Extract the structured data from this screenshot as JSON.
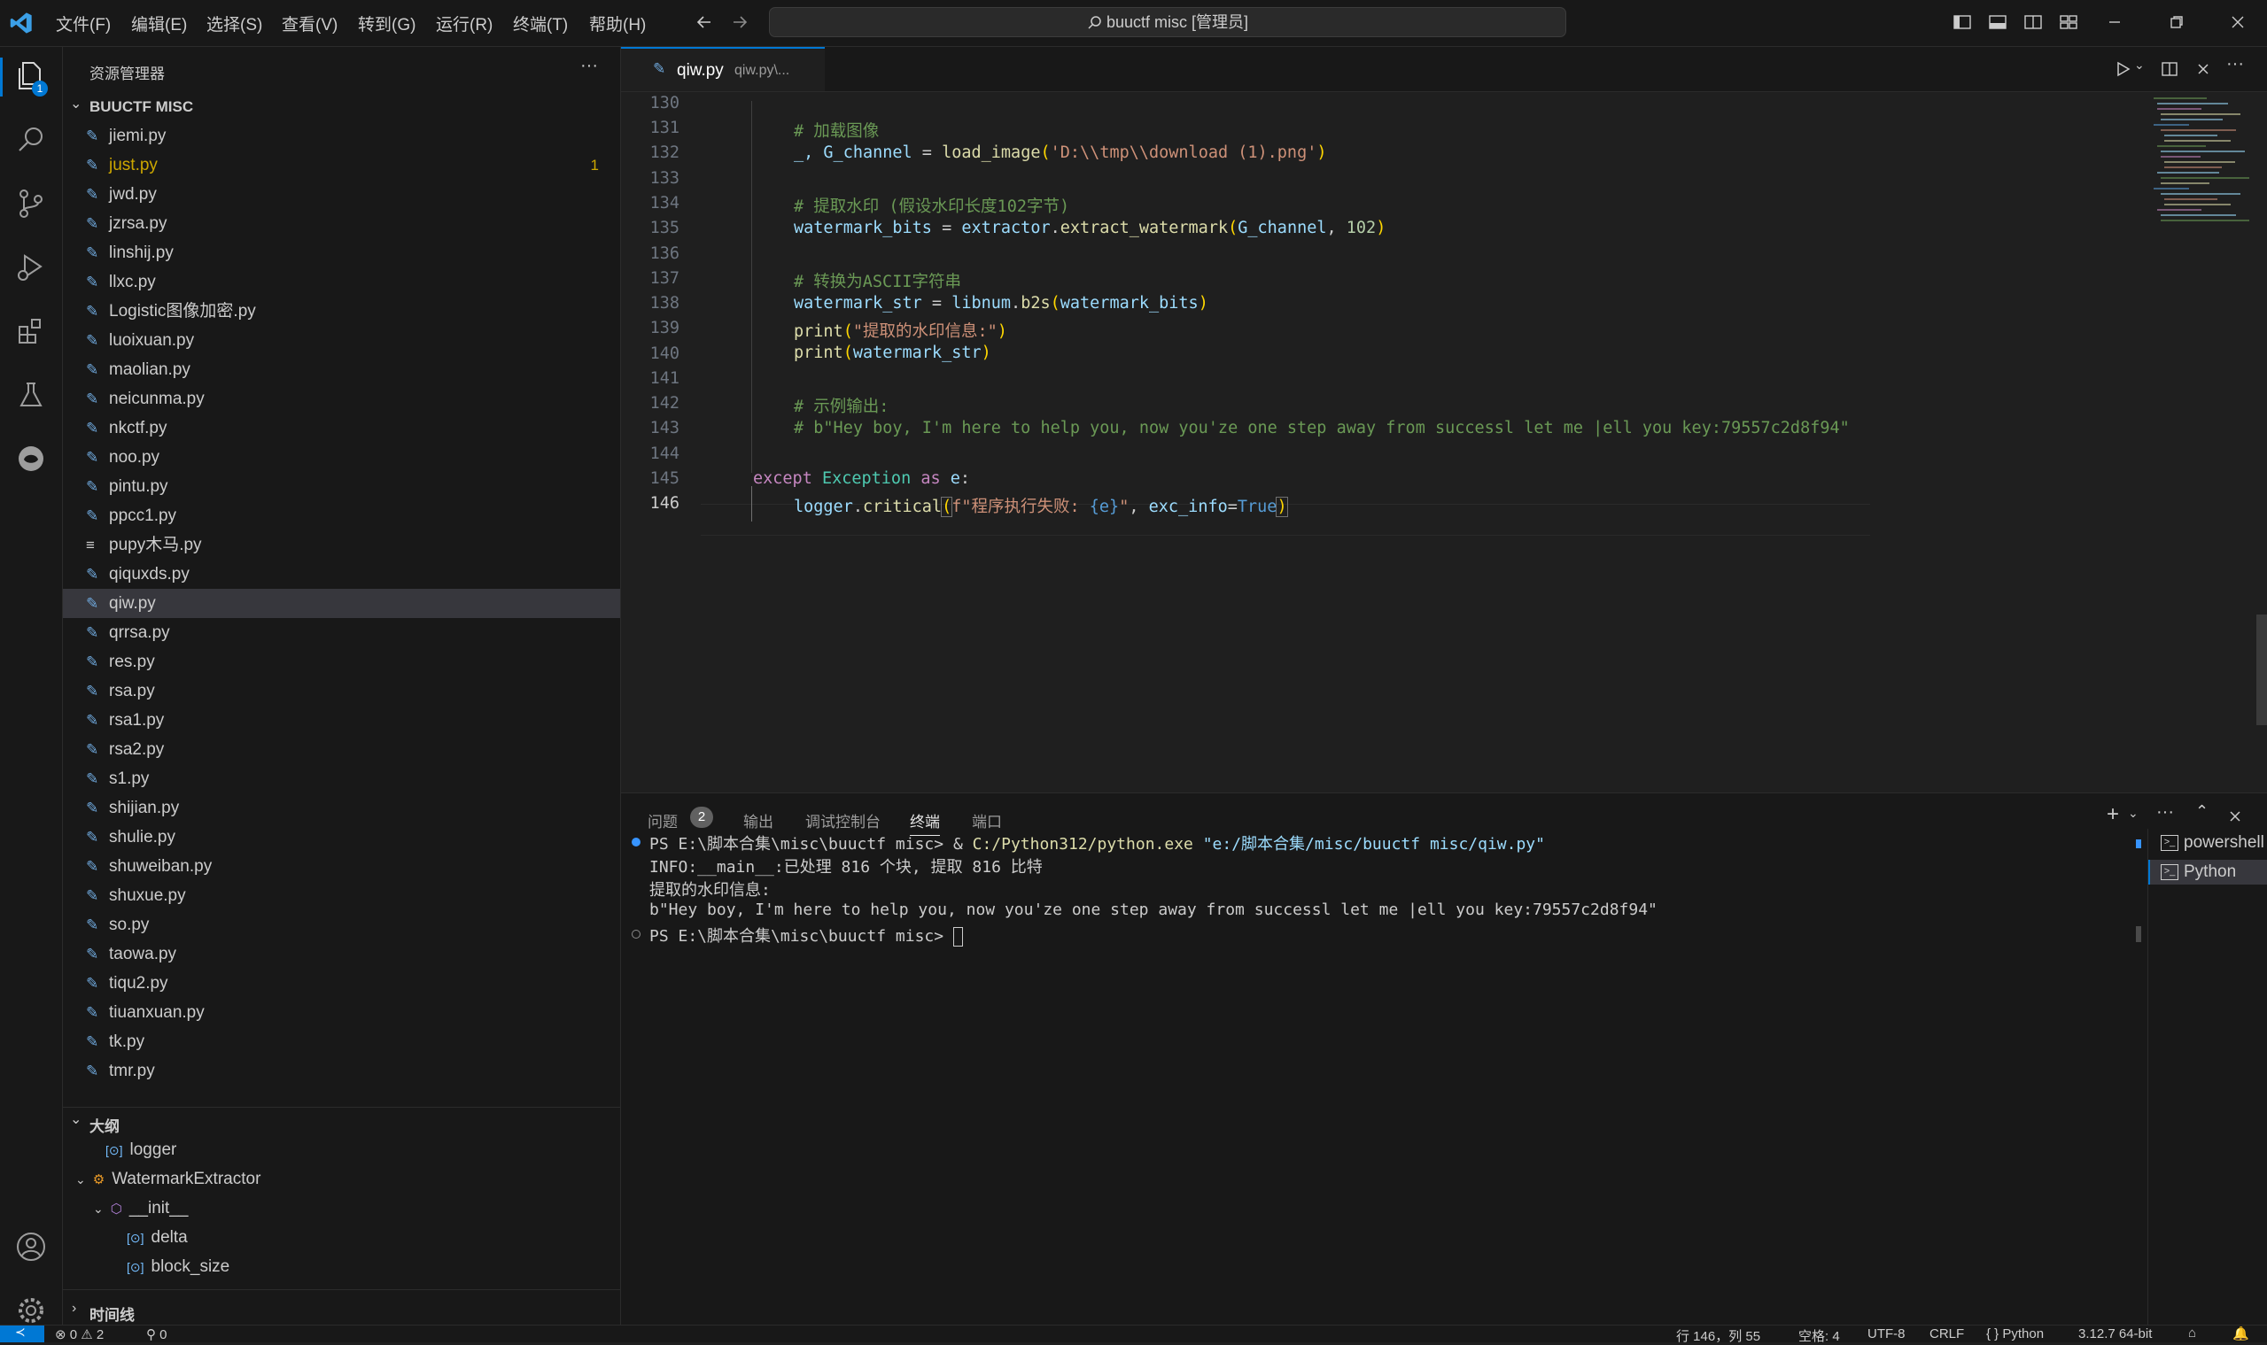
{
  "titlebar": {
    "menus": [
      "文件(F)",
      "编辑(E)",
      "选择(S)",
      "查看(V)",
      "转到(G)",
      "运行(R)",
      "终端(T)",
      "帮助(H)"
    ],
    "search_text": "buuctf misc [管理员]"
  },
  "activity": {
    "explorer_badge": "1"
  },
  "sidebar": {
    "title": "资源管理器",
    "folder": "BUUCTF MISC",
    "files": [
      {
        "name": "jiemi.py",
        "badge": ""
      },
      {
        "name": "just.py",
        "badge": "1"
      },
      {
        "name": "jwd.py",
        "badge": ""
      },
      {
        "name": "jzrsa.py",
        "badge": ""
      },
      {
        "name": "linshij.py",
        "badge": ""
      },
      {
        "name": "llxc.py",
        "badge": ""
      },
      {
        "name": "Logistic图像加密.py",
        "badge": ""
      },
      {
        "name": "luoixuan.py",
        "badge": ""
      },
      {
        "name": "maolian.py",
        "badge": ""
      },
      {
        "name": "neicunma.py",
        "badge": ""
      },
      {
        "name": "nkctf.py",
        "badge": ""
      },
      {
        "name": "noo.py",
        "badge": ""
      },
      {
        "name": "pintu.py",
        "badge": ""
      },
      {
        "name": "ppcc1.py",
        "badge": ""
      },
      {
        "name": "pupy木马.py",
        "badge": ""
      },
      {
        "name": "qiquxds.py",
        "badge": ""
      },
      {
        "name": "qiw.py",
        "badge": ""
      },
      {
        "name": "qrrsa.py",
        "badge": ""
      },
      {
        "name": "res.py",
        "badge": ""
      },
      {
        "name": "rsa.py",
        "badge": ""
      },
      {
        "name": "rsa1.py",
        "badge": ""
      },
      {
        "name": "rsa2.py",
        "badge": ""
      },
      {
        "name": "s1.py",
        "badge": ""
      },
      {
        "name": "shijian.py",
        "badge": ""
      },
      {
        "name": "shulie.py",
        "badge": ""
      },
      {
        "name": "shuweiban.py",
        "badge": ""
      },
      {
        "name": "shuxue.py",
        "badge": ""
      },
      {
        "name": "so.py",
        "badge": ""
      },
      {
        "name": "taowa.py",
        "badge": ""
      },
      {
        "name": "tiqu2.py",
        "badge": ""
      },
      {
        "name": "tiuanxuan.py",
        "badge": ""
      },
      {
        "name": "tk.py",
        "badge": ""
      },
      {
        "name": "tmr.py",
        "badge": ""
      }
    ],
    "outline_title": "大纲",
    "outline": [
      "logger",
      "WatermarkExtractor",
      "__init__",
      "delta",
      "block_size"
    ],
    "timeline_title": "时间线"
  },
  "editor": {
    "tab_name": "qiw.py",
    "tab_path": "qiw.py\\...",
    "line_numbers": [
      "130",
      "131",
      "132",
      "133",
      "134",
      "135",
      "136",
      "137",
      "138",
      "139",
      "140",
      "141",
      "142",
      "143",
      "144",
      "145",
      "146"
    ],
    "code": {
      "c131": "# 加载图像",
      "l132_a": "_, ",
      "l132_b": "G_channel",
      "l132_c": " = ",
      "l132_d": "load_image",
      "l132_e": "(",
      "l132_f": "'D:\\\\tmp\\\\download (1).png'",
      "l132_g": ")",
      "c134": "# 提取水印 (假设水印长度102字节)",
      "l135_a": "watermark_bits",
      "l135_b": " = ",
      "l135_c": "extractor",
      "l135_d": ".",
      "l135_e": "extract_watermark",
      "l135_f": "(",
      "l135_g": "G_channel",
      "l135_h": ", ",
      "l135_i": "102",
      "l135_j": ")",
      "c137": "# 转换为ASCII字符串",
      "l138_a": "watermark_str",
      "l138_b": " = ",
      "l138_c": "libnum",
      "l138_d": ".",
      "l138_e": "b2s",
      "l138_f": "(",
      "l138_g": "watermark_bits",
      "l138_h": ")",
      "l139_a": "print",
      "l139_b": "(",
      "l139_c": "\"提取的水印信息:\"",
      "l139_d": ")",
      "l140_a": "print",
      "l140_b": "(",
      "l140_c": "watermark_str",
      "l140_d": ")",
      "c142": "# 示例输出:",
      "c143": "# b\"Hey boy, I'm here to help you, now you'ze one step away from successl let me |ell you key:79557c2d8f94\"",
      "l145_a": "except",
      "l145_b": " ",
      "l145_c": "Exception",
      "l145_d": " ",
      "l145_e": "as",
      "l145_f": " ",
      "l145_g": "e",
      "l145_h": ":",
      "l146_a": "logger",
      "l146_b": ".",
      "l146_c": "critical",
      "l146_d": "(",
      "l146_e": "f\"程序执行失败: ",
      "l146_f": "{e}",
      "l146_g": "\"",
      "l146_h": ", ",
      "l146_i": "exc_info",
      "l146_j": "=",
      "l146_k": "True",
      "l146_l": ")"
    }
  },
  "panel": {
    "tabs": [
      "问题",
      "输出",
      "调试控制台",
      "终端",
      "端口"
    ],
    "problems_count": "2",
    "terminal": {
      "l1_prompt": "PS E:\\脚本合集\\misc\\buuctf misc> ",
      "l1_amp": "& ",
      "l1_exe": "C:/Python312/python.exe",
      "l1_arg": " \"e:/脚本合集/misc/buuctf misc/qiw.py\"",
      "l2": "INFO:__main__:已处理 816 个块, 提取 816 比特",
      "l3": "提取的水印信息:",
      "l4": "b\"Hey boy, I'm here to help you, now you'ze one step away from successl let me |ell you key:79557c2d8f94\"",
      "l5": "PS E:\\脚本合集\\misc\\buuctf misc> "
    },
    "terminals": [
      "powershell",
      "Python"
    ]
  },
  "status": {
    "errors": "0",
    "warnings": "2",
    "ports": "0",
    "position": "行 146，列 55",
    "spaces": "空格: 4",
    "encoding": "UTF-8",
    "eol": "CRLF",
    "language": "Python",
    "interpreter": "3.12.7 64-bit"
  },
  "colors": {
    "accent": "#0078d4",
    "background": "#1f1f1f",
    "sidebar": "#181818",
    "warning": "#cca700"
  }
}
